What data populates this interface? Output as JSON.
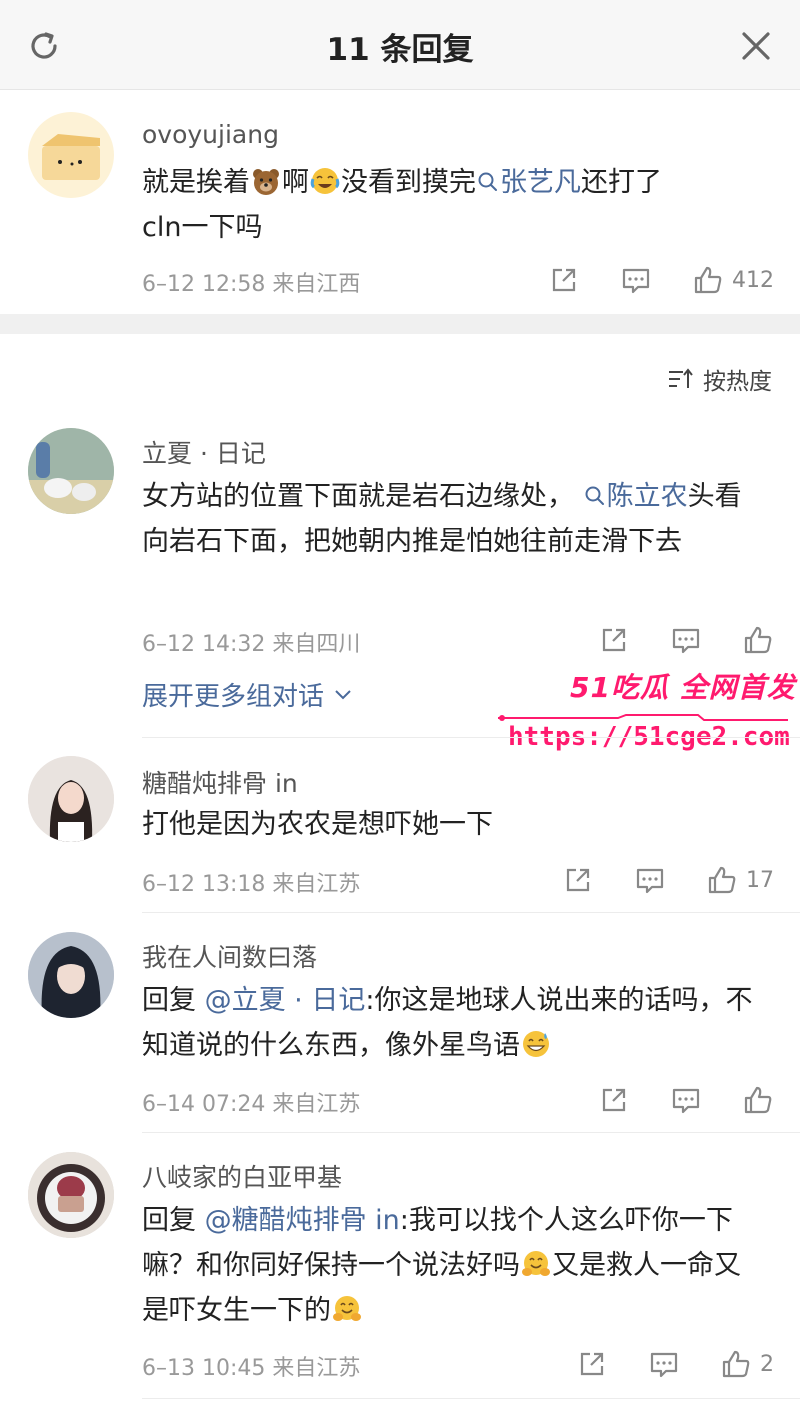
{
  "header": {
    "title": "11 条回复"
  },
  "sort": {
    "label": "按热度"
  },
  "comments": [
    {
      "user": "ovoyujiang",
      "text_a": "就是挨着",
      "text_b": "啊",
      "text_c": "没看到摸完",
      "topic": "张艺凡",
      "text_d": "还打了",
      "text_e": "cln一下吗",
      "time": "6–12 12:58",
      "location": "来自江西",
      "likes": "412"
    },
    {
      "user": "立夏 · 日记",
      "text_a": "女方站的位置下面就是岩石边缘处，",
      "topic": "陈立农",
      "text_b": "头看向岩石下面，把她朝内推是怕她往前走滑下去",
      "time": "6–12 14:32",
      "location": "来自四川",
      "likes": ""
    },
    {
      "user": "糖醋炖排骨 in",
      "text_a": "打他是因为农农是想吓她一下",
      "time": "6–12 13:18",
      "location": "来自江苏",
      "likes": "17"
    },
    {
      "user": "我在人间数曰落",
      "reply_prefix": "回复",
      "mention": "@立夏 · 日记",
      "text_a": ":你这是地球人说出来的话吗，不知道说的什么东西，像外星鸟语",
      "time": "6–14 07:24",
      "location": "来自江苏",
      "likes": ""
    },
    {
      "user": "八岐家的白亚甲基",
      "reply_prefix": "回复",
      "mention": "@糖醋炖排骨 in",
      "text_a": ":我可以找个人这么吓你一下嘛？和你同好保持一个说法好吗",
      "text_b": "又是救人一命又是吓女生一下的",
      "time": "6–13 10:45",
      "location": "来自江苏",
      "likes": "2"
    }
  ],
  "expand": {
    "label": "展开更多组对话"
  },
  "watermark": {
    "line1": "51吃瓜 全网首发",
    "line2": "https://51cge2.com"
  },
  "colors": {
    "link": "#4a6a9b",
    "watermark": "#ff1a6e",
    "meta": "#999999"
  }
}
